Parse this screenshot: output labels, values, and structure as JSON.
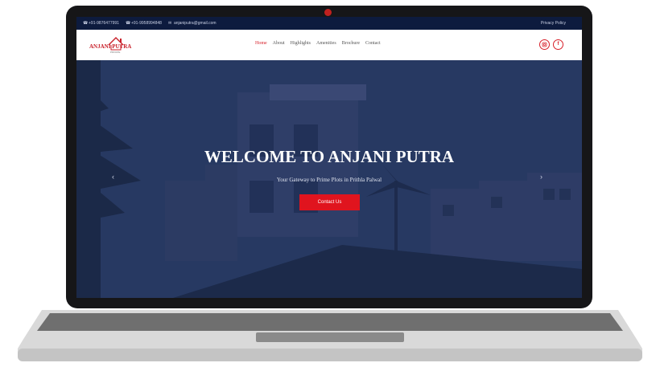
{
  "topbar": {
    "phone1": "+91-9876477991",
    "phone2": "+91-9958994848",
    "email": "anjaniputra@gmail.com",
    "privacy": "Privacy Policy"
  },
  "logo": {
    "name": "ANJANI PUTRA",
    "tagline": "PRIVATE"
  },
  "nav": {
    "items": [
      "Home",
      "About",
      "Highlights",
      "Amenities",
      "Brochure",
      "Contact"
    ],
    "active": "Home"
  },
  "social": {
    "instagram_icon": "instagram-icon",
    "facebook_icon": "facebook-icon",
    "facebook_glyph": "f"
  },
  "hero": {
    "title": "WELCOME TO ANJANI PUTRA",
    "subtitle": "Your Gateway to Prime Plots in Prithla Palwal",
    "cta_label": "Contact Us"
  },
  "colors": {
    "accent": "#e0141e",
    "topbar": "#0d1b3e",
    "hero_overlay": "#24355e",
    "laptop_frame": "#161618"
  }
}
